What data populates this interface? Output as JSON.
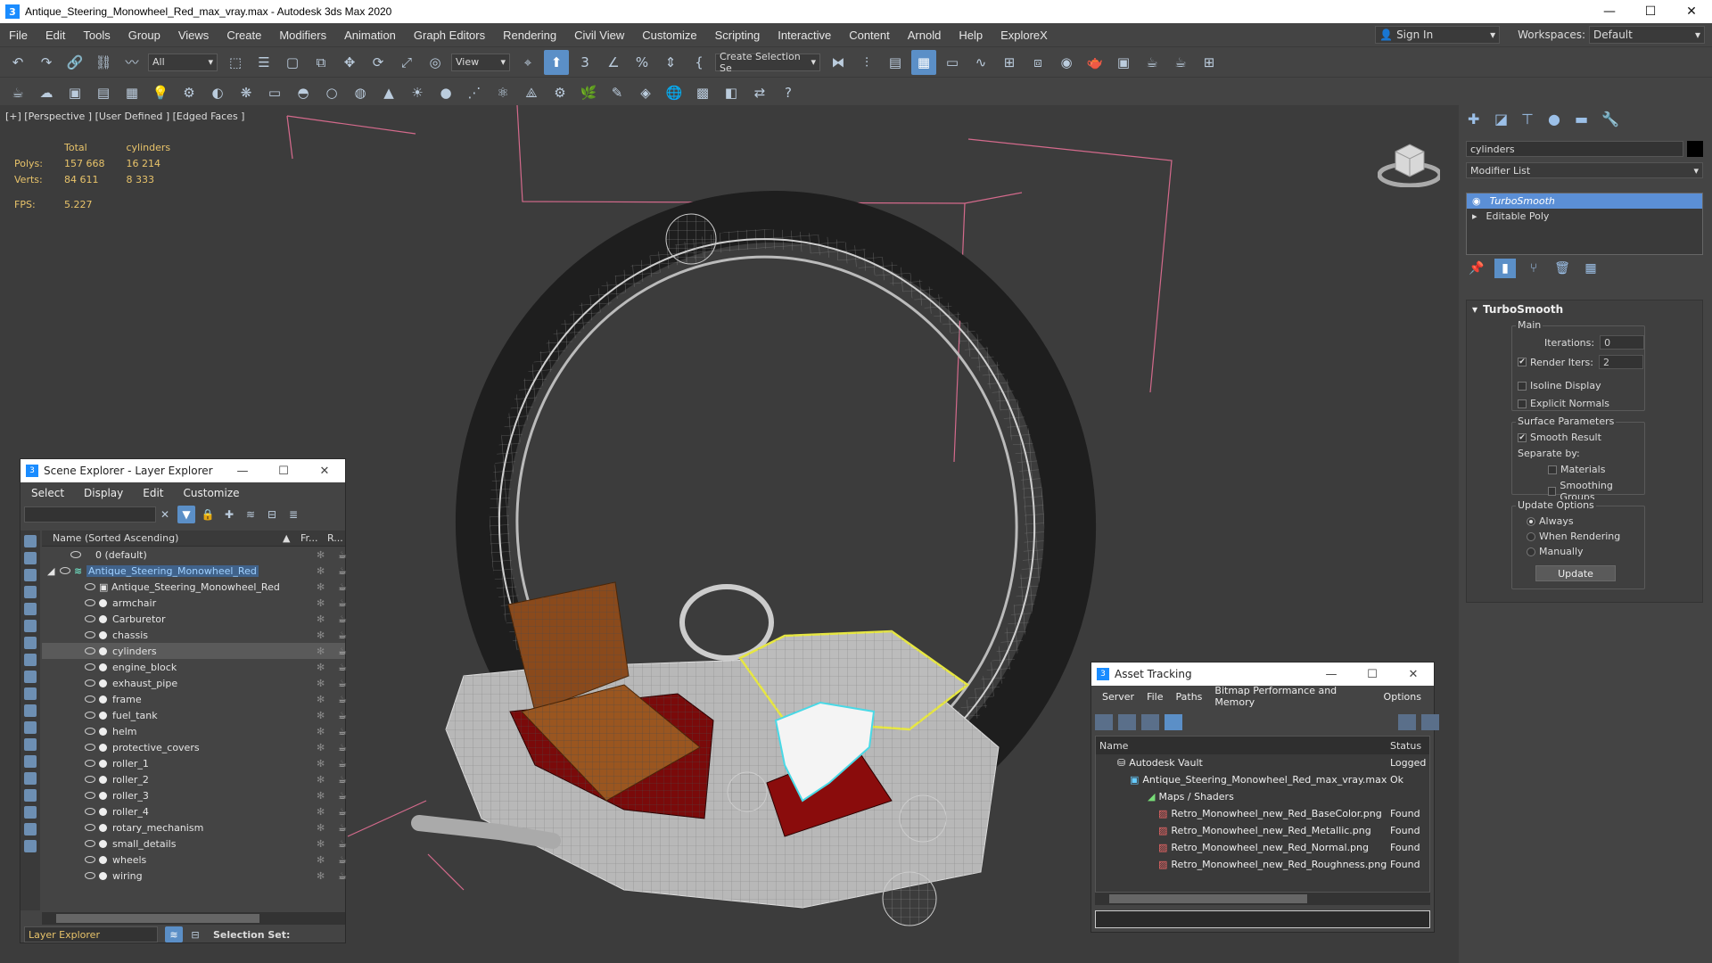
{
  "window": {
    "title": "Antique_Steering_Monowheel_Red_max_vray.max - Autodesk 3ds Max 2020",
    "app_icon_label": "3",
    "minimize": "—",
    "maximize": "☐",
    "close": "✕"
  },
  "menu": {
    "items": [
      "File",
      "Edit",
      "Tools",
      "Group",
      "Views",
      "Create",
      "Modifiers",
      "Animation",
      "Graph Editors",
      "Rendering",
      "Civil View",
      "Customize",
      "Scripting",
      "Interactive",
      "Content",
      "Arnold",
      "Help",
      "ExploreX"
    ],
    "sign_in": "Sign In",
    "workspaces_label": "Workspaces:",
    "workspaces_value": "Default"
  },
  "toolbar": {
    "selection_filter": "All",
    "ref_coord": "View",
    "named_selection": "Create Selection Se"
  },
  "viewport": {
    "label": "[+] [Perspective ] [User Defined ] [Edged Faces ]",
    "stats": {
      "header_total": "Total",
      "header_sel": "cylinders",
      "polys_label": "Polys:",
      "polys_total": "157 668",
      "polys_sel": "16 214",
      "verts_label": "Verts:",
      "verts_total": "84 611",
      "verts_sel": "8 333",
      "fps_label": "FPS:",
      "fps_value": "5.227"
    }
  },
  "scene_explorer": {
    "title": "Scene Explorer - Layer Explorer",
    "menu": [
      "Select",
      "Display",
      "Edit",
      "Customize"
    ],
    "col_name": "Name (Sorted Ascending)",
    "col_fr": "Fr...",
    "col_r": "R...",
    "rows": [
      {
        "name": "0 (default)",
        "indent": 0
      },
      {
        "name": "Antique_Steering_Monowheel_Red",
        "indent": 0
      },
      {
        "name": "Antique_Steering_Monowheel_Red",
        "indent": 1
      },
      {
        "name": "armchair",
        "indent": 1
      },
      {
        "name": "Carburetor",
        "indent": 1
      },
      {
        "name": "chassis",
        "indent": 1
      },
      {
        "name": "cylinders",
        "indent": 1
      },
      {
        "name": "engine_block",
        "indent": 1
      },
      {
        "name": "exhaust_pipe",
        "indent": 1
      },
      {
        "name": "frame",
        "indent": 1
      },
      {
        "name": "fuel_tank",
        "indent": 1
      },
      {
        "name": "helm",
        "indent": 1
      },
      {
        "name": "protective_covers",
        "indent": 1
      },
      {
        "name": "roller_1",
        "indent": 1
      },
      {
        "name": "roller_2",
        "indent": 1
      },
      {
        "name": "roller_3",
        "indent": 1
      },
      {
        "name": "roller_4",
        "indent": 1
      },
      {
        "name": "rotary_mechanism",
        "indent": 1
      },
      {
        "name": "small_details",
        "indent": 1
      },
      {
        "name": "wheels",
        "indent": 1
      },
      {
        "name": "wiring",
        "indent": 1
      }
    ],
    "footer_explorer": "Layer Explorer",
    "footer_selset": "Selection Set:"
  },
  "asset_tracking": {
    "title": "Asset Tracking",
    "menu": [
      "Server",
      "File",
      "Paths",
      "Bitmap Performance and Memory",
      "Options"
    ],
    "col_name": "Name",
    "col_status": "Status",
    "rows": [
      {
        "name": "Autodesk Vault",
        "status": "Logged",
        "indent": 1
      },
      {
        "name": "Antique_Steering_Monowheel_Red_max_vray.max",
        "status": "Ok",
        "indent": 2
      },
      {
        "name": "Maps / Shaders",
        "status": "",
        "indent": 3
      },
      {
        "name": "Retro_Monowheel_new_Red_BaseColor.png",
        "status": "Found",
        "indent": 4
      },
      {
        "name": "Retro_Monowheel_new_Red_Metallic.png",
        "status": "Found",
        "indent": 4
      },
      {
        "name": "Retro_Monowheel_new_Red_Normal.png",
        "status": "Found",
        "indent": 4
      },
      {
        "name": "Retro_Monowheel_new_Red_Roughness.png",
        "status": "Found",
        "indent": 4
      }
    ]
  },
  "command_panel": {
    "object_name": "cylinders",
    "modifier_list": "Modifier List",
    "stack": [
      "TurboSmooth",
      "Editable Poly"
    ],
    "rollout_title": "TurboSmooth",
    "main_label": "Main",
    "iterations_label": "Iterations:",
    "iterations_value": "0",
    "render_iters_label": "Render Iters:",
    "render_iters_value": "2",
    "isoline_label": "Isoline Display",
    "explicit_label": "Explicit Normals",
    "surface_label": "Surface Parameters",
    "smooth_label": "Smooth Result",
    "separate_label": "Separate by:",
    "materials_label": "Materials",
    "smoothing_label": "Smoothing Groups",
    "update_options_label": "Update Options",
    "always_label": "Always",
    "when_rendering_label": "When Rendering",
    "manually_label": "Manually",
    "update_button": "Update"
  }
}
